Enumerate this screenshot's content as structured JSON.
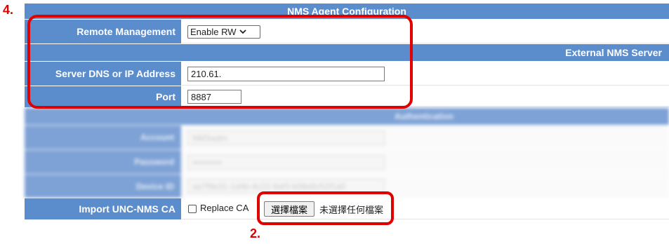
{
  "annotations": {
    "step_top": "4.",
    "step_bottom": "2."
  },
  "section": {
    "title": "NMS Agent Configuration"
  },
  "remote_management": {
    "label": "Remote Management",
    "selected": "Enable RW"
  },
  "external_server": {
    "title": "External NMS Server",
    "address_label": "Server DNS or IP Address",
    "address_value": "210.61.",
    "port_label": "Port",
    "port_value": "8887"
  },
  "redacted_section": {
    "title": "Authentication",
    "rows": [
      {
        "label": "Account",
        "value": "NMSadm"
      },
      {
        "label": "Password",
        "value": "••••••••••"
      },
      {
        "label": "Device ID",
        "value": "aa7f9e31-1d4b-4c22-9af3-b08e6c52f1a0"
      }
    ]
  },
  "import_ca": {
    "label": "Import UNC-NMS CA",
    "replace_label": "Replace CA",
    "choose_file_button": "選擇檔案",
    "no_file_text": "未選擇任何檔案"
  },
  "colors": {
    "header_blue": "#5b8ccc",
    "annotation_red": "#e00000"
  }
}
